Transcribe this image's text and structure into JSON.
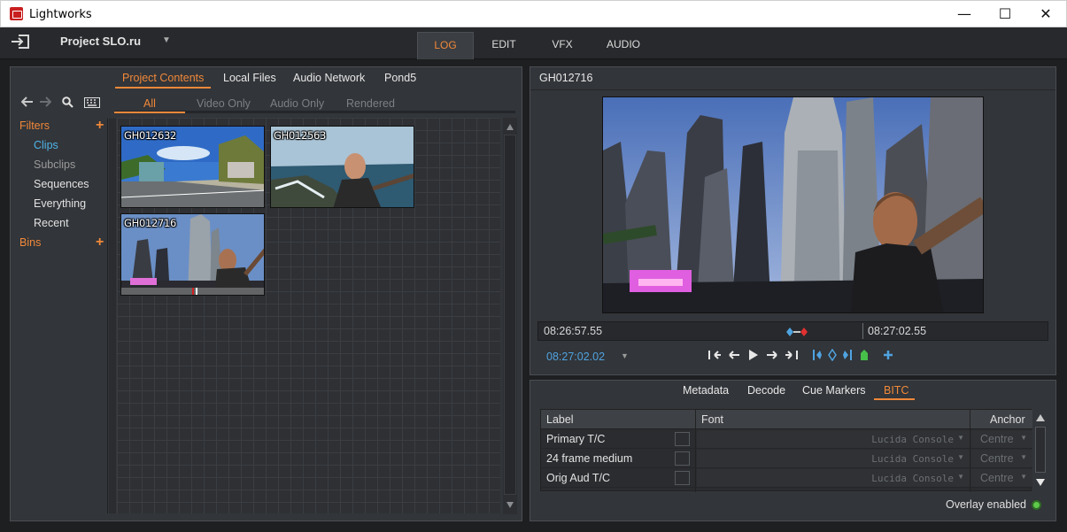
{
  "window": {
    "title": "Lightworks",
    "minimize": "—",
    "maximize": "☐",
    "close": "✕"
  },
  "appbar": {
    "project_name": "Project SLO.ru",
    "project_caret": "▼",
    "tabs": [
      {
        "label": "LOG",
        "active": true
      },
      {
        "label": "EDIT"
      },
      {
        "label": "VFX"
      },
      {
        "label": "AUDIO"
      }
    ]
  },
  "content_panel": {
    "source_tabs": [
      {
        "label": "Project Contents",
        "active": true
      },
      {
        "label": "Local Files"
      },
      {
        "label": "Audio Network"
      },
      {
        "label": "Pond5"
      }
    ],
    "filter_tabs": [
      {
        "label": "All",
        "active": true
      },
      {
        "label": "Video Only"
      },
      {
        "label": "Audio Only"
      },
      {
        "label": "Rendered"
      }
    ],
    "sidebar": {
      "filters_heading": "Filters",
      "items": [
        {
          "label": "Clips",
          "selected": true
        },
        {
          "label": "Subclips",
          "dim": true
        },
        {
          "label": "Sequences"
        },
        {
          "label": "Everything"
        },
        {
          "label": "Recent"
        }
      ],
      "bins_heading": "Bins",
      "plus": "+"
    },
    "clips": [
      {
        "name": "GH012632"
      },
      {
        "name": "GH012563"
      },
      {
        "name": "GH012716"
      }
    ]
  },
  "viewer": {
    "title": "GH012716",
    "timecode_start": "08:26:57.55",
    "timecode_end": "08:27:02.55",
    "timecode_current": "08:27:02.02",
    "tc_caret": "▼"
  },
  "bitc_panel": {
    "tabs": [
      {
        "label": "Metadata"
      },
      {
        "label": "Decode"
      },
      {
        "label": "Cue Markers"
      },
      {
        "label": "BITC",
        "active": true
      }
    ],
    "columns": {
      "label": "Label",
      "font": "Font",
      "anchor": "Anchor"
    },
    "rows": [
      {
        "label": "Primary T/C",
        "font": "Lucida Console",
        "anchor": "Centre"
      },
      {
        "label": "24 frame medium",
        "font": "Lucida Console",
        "anchor": "Centre"
      },
      {
        "label": "Orig Aud T/C",
        "font": "Lucida Console",
        "anchor": "Centre"
      }
    ],
    "dropdown_arrow": "▼",
    "overlay_label": "Overlay enabled"
  },
  "colors": {
    "accent": "#f0883a",
    "selection_blue": "#4fb3e8",
    "background": "#1e1f21",
    "panel": "#323539"
  }
}
